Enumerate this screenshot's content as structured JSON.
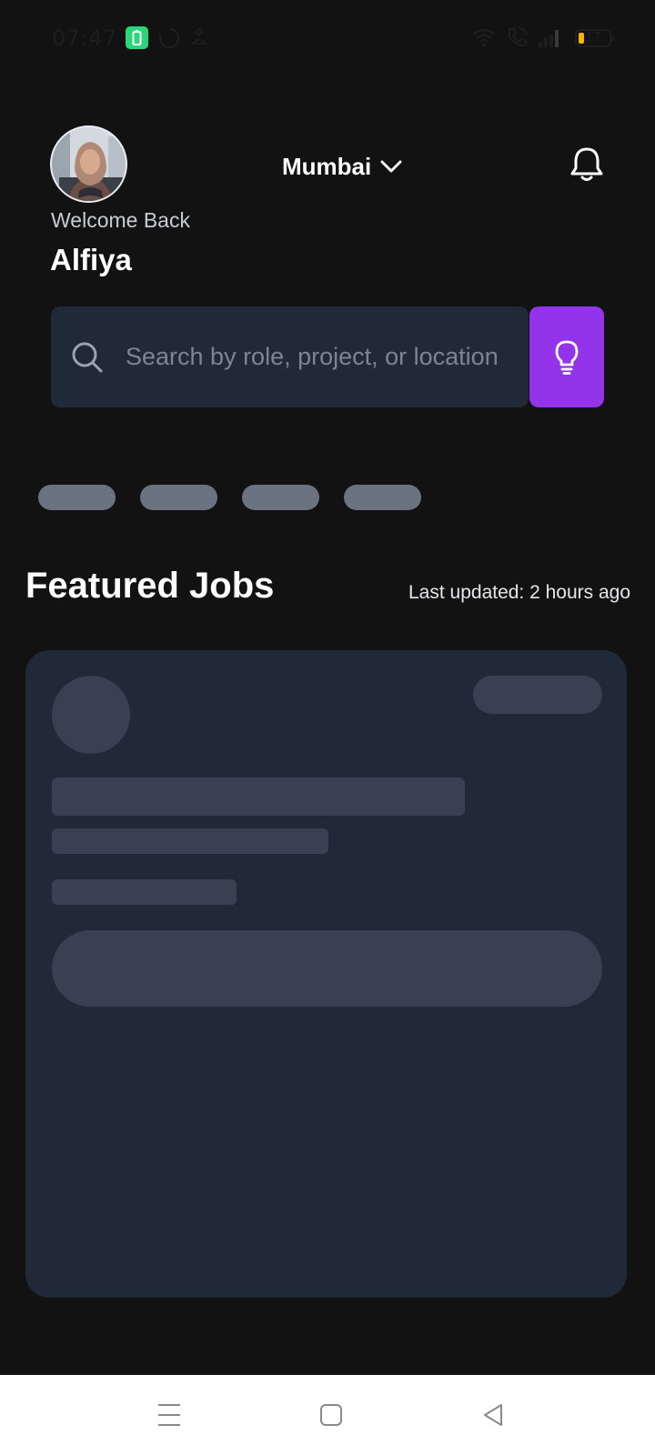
{
  "status_bar": {
    "time": "07:47",
    "battery_level": "17",
    "icons": [
      "battery-saver-icon",
      "loading-ring-icon",
      "hanger-icon",
      "wifi-icon",
      "wifi-calling-icon",
      "signal-icon",
      "battery-icon"
    ]
  },
  "header": {
    "welcome_text": "Welcome Back",
    "user_name": "Alfiya",
    "location": "Mumbai",
    "avatar_icon": "user-avatar-photo",
    "notification_icon": "bell-icon"
  },
  "search": {
    "placeholder": "Search by role, project, or location",
    "value": "",
    "action_icon": "lightbulb-icon"
  },
  "featured": {
    "title": "Featured Jobs",
    "last_updated": "Last updated: 2 hours ago"
  },
  "colors": {
    "background": "#121212",
    "card": "#1f2937",
    "skeleton": "#374151",
    "chip_skeleton": "#6b7280",
    "accent": "#9333ea"
  },
  "navigation": {
    "buttons": [
      "menu-icon",
      "home-square-icon",
      "back-triangle-icon"
    ]
  }
}
